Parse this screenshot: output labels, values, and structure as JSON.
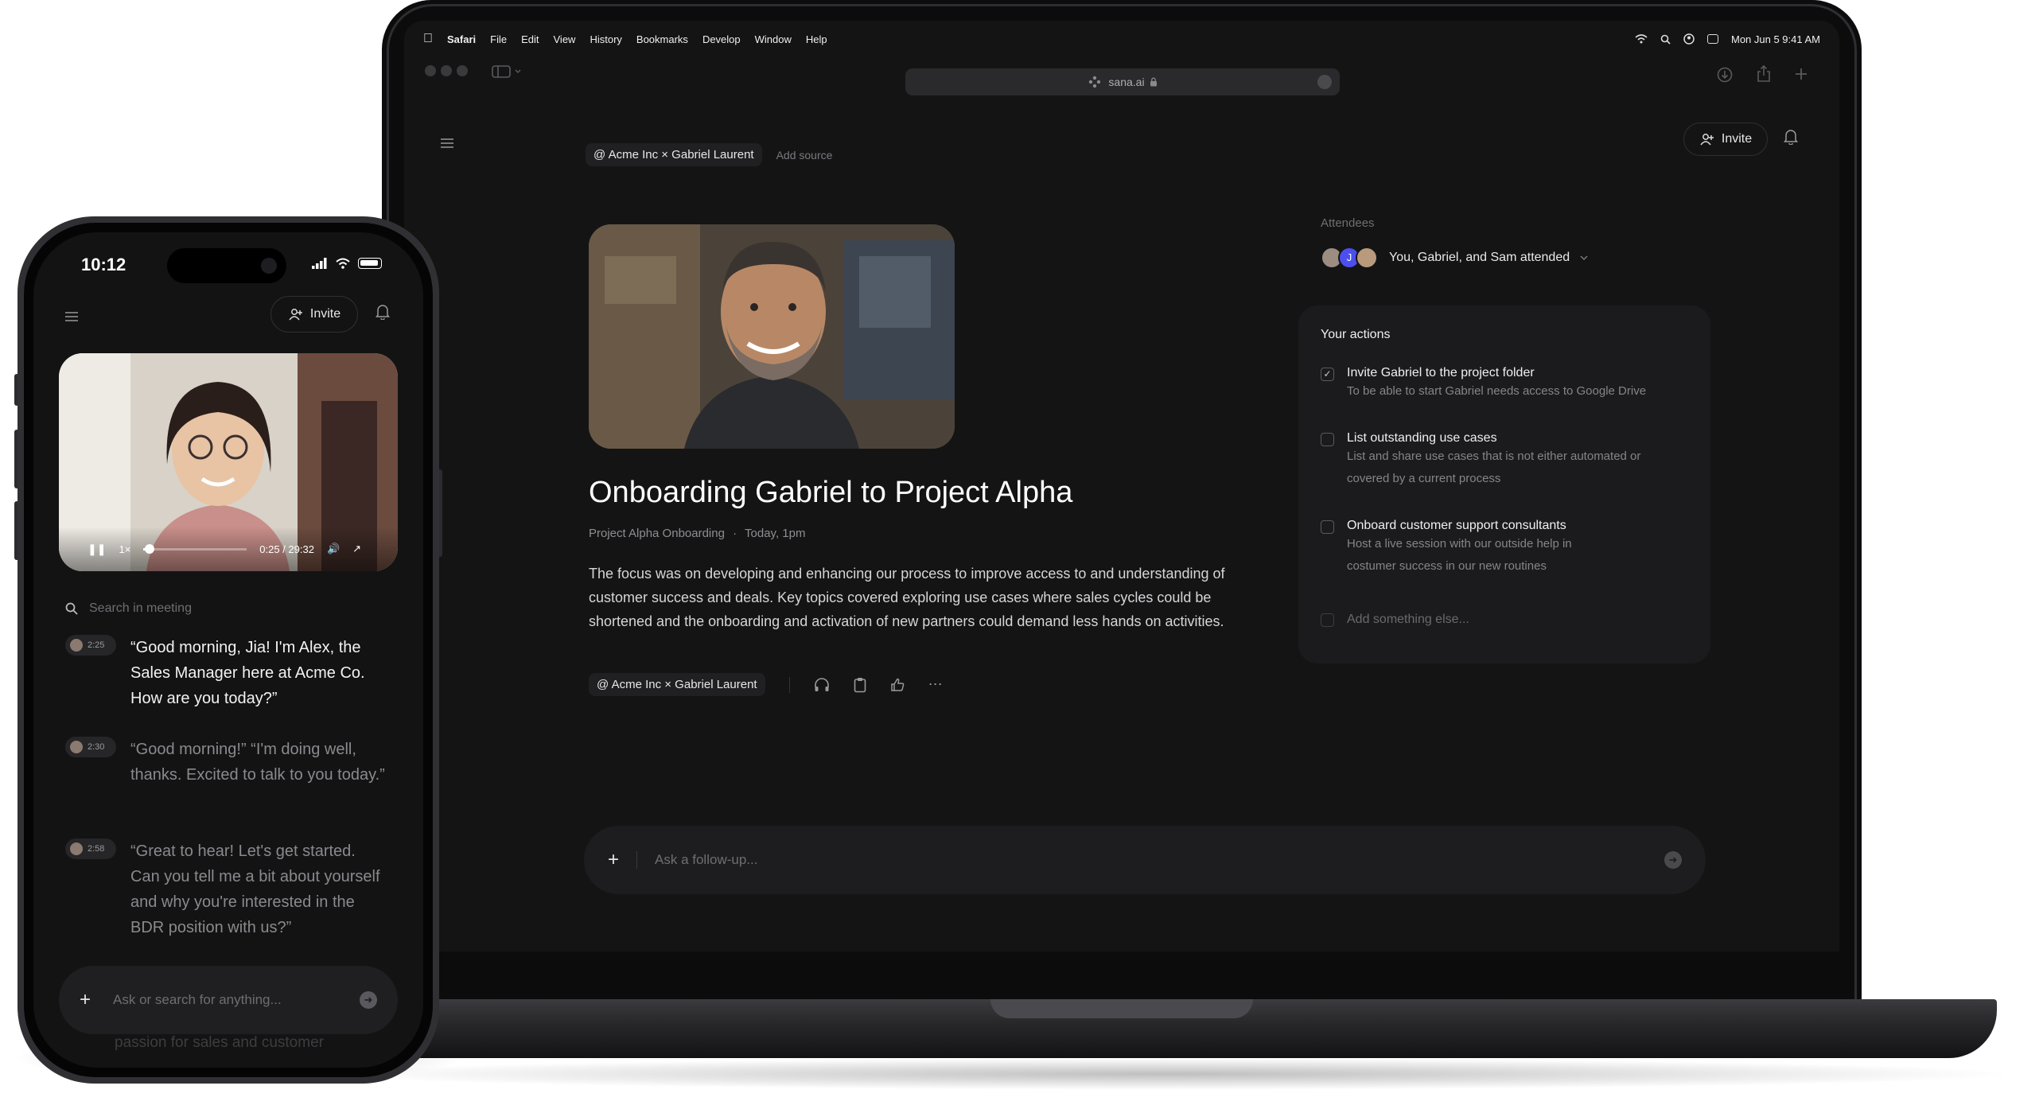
{
  "menubar": {
    "app": "Safari",
    "items": [
      "File",
      "Edit",
      "View",
      "History",
      "Bookmarks",
      "Develop",
      "Window",
      "Help"
    ],
    "datetime": "Mon Jun 5  9:41 AM"
  },
  "browser": {
    "url": "sana.ai"
  },
  "meeting": {
    "source_chip": "@ Acme Inc × Gabriel Laurent",
    "add_source": "Add source",
    "invite": "Invite",
    "title": "Onboarding Gabriel to Project Alpha",
    "project": "Project Alpha Onboarding",
    "dot": "·",
    "time": "Today, 1pm",
    "summary": "The focus was on developing and enhancing our process to improve access to and understanding of customer success and deals. Key topics covered exploring use cases where sales cycles could be shortened and the onboarding and activation of new partners could demand less hands on activities.",
    "footer_chip": "@ Acme Inc × Gabriel Laurent"
  },
  "attendees": {
    "label": "Attendees",
    "avatar_initial": "J",
    "summary": "You, Gabriel, and Sam attended"
  },
  "actions": {
    "heading": "Your actions",
    "items": [
      {
        "title": "Invite Gabriel to the project folder",
        "desc": "To be able to start Gabriel needs access to Google Drive",
        "checked": true
      },
      {
        "title": "List outstanding use cases",
        "desc": "List and share use cases that is not either automated or covered by a current process",
        "checked": false
      },
      {
        "title": "Onboard customer support consultants",
        "desc": "Host a live session with our outside help in costumer success in our new routines",
        "checked": false
      }
    ],
    "add_placeholder": "Add something else..."
  },
  "followup": {
    "placeholder": "Ask a follow-up..."
  },
  "phone": {
    "time": "10:12",
    "invite": "Invite",
    "video": {
      "speed": "1×",
      "progress": "0:25 / 29:32"
    },
    "search_placeholder": "Search in meeting",
    "transcript": [
      {
        "time": "2:25",
        "text": "“Good morning, Jia! I'm Alex, the Sales Manager here at Acme Co. How are you today?”"
      },
      {
        "time": "2:30",
        "text": "“Good morning!” “I'm doing well, thanks. Excited to talk to you today.”"
      },
      {
        "time": "2:58",
        "text": "“Great to hear! Let's get started. Can you tell me a bit about yourself and why you're interested in the BDR position with us?”"
      }
    ],
    "ask_placeholder": "Ask or search for anything...",
    "under_text": "passion for sales and customer"
  },
  "colors": {
    "screen_bg": "#141415",
    "panel_bg": "#1b1b1d",
    "text": "#e6e6e6",
    "muted": "#85858a"
  }
}
